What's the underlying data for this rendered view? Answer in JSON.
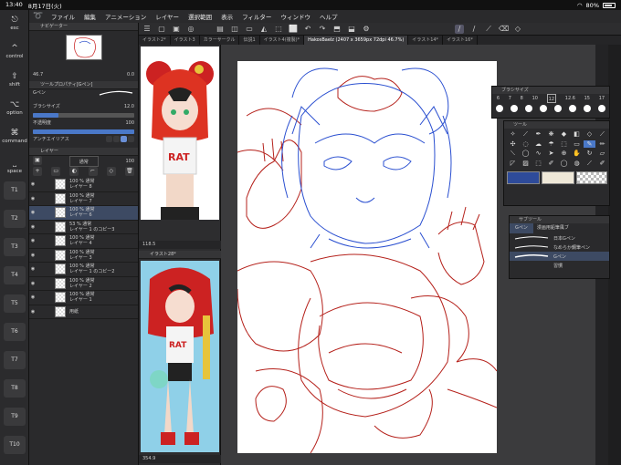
{
  "status": {
    "time": "13:40",
    "date": "8月17日(火)",
    "battery": "80%",
    "battery_level": 0.8
  },
  "menu": [
    "ファイル",
    "編集",
    "アニメーション",
    "レイヤー",
    "選択範囲",
    "表示",
    "フィルター",
    "ウィンドウ",
    "ヘルプ"
  ],
  "modifiers": [
    {
      "glyph": "⎋",
      "label": "esc"
    },
    {
      "glyph": "^",
      "label": "control"
    },
    {
      "glyph": "⇧",
      "label": "shift"
    },
    {
      "glyph": "⌥",
      "label": "option"
    },
    {
      "glyph": "⌘",
      "label": "command"
    },
    {
      "glyph": "⎵",
      "label": "space"
    }
  ],
  "tkeys": [
    "T1",
    "T2",
    "T3",
    "T4",
    "T5",
    "T6",
    "T7",
    "T8",
    "T9",
    "T10"
  ],
  "tabs": [
    "イラスト2*",
    "イラスト3",
    "カラーサークル",
    "伝説1",
    "イラスト4(複製)*",
    "HakosBaelz (2407 x 3659px 72dpi 46.7%)",
    "イラスト14*",
    "イラスト16*"
  ],
  "navigator": {
    "title": "ナビゲーター",
    "zoom": "46.7",
    "angle": "0.0"
  },
  "toolprop": {
    "title": "ツールプロパティ[Gペン]",
    "brush_label": "Gペン",
    "size_label": "ブラシサイズ",
    "size_value": "12.0",
    "size_level": 0.25,
    "opacity_label": "不透明度",
    "opacity_value": "100",
    "opacity_level": 1.0,
    "aa_label": "アンチエイリアス"
  },
  "layers_panel": {
    "title": "レイヤー",
    "blend": "通常",
    "opacity": "100",
    "items": [
      {
        "pct": "100 %",
        "mode": "通常",
        "name": "レイヤー 8",
        "selected": false
      },
      {
        "pct": "100 %",
        "mode": "通常",
        "name": "レイヤー 7",
        "selected": false
      },
      {
        "pct": "100 %",
        "mode": "通常",
        "name": "レイヤー 6",
        "selected": true
      },
      {
        "pct": "53 %",
        "mode": "通常",
        "name": "レイヤー 1 のコピー3",
        "selected": false
      },
      {
        "pct": "100 %",
        "mode": "通常",
        "name": "レイヤー 4",
        "selected": false
      },
      {
        "pct": "100 %",
        "mode": "通常",
        "name": "レイヤー 3",
        "selected": false
      },
      {
        "pct": "100 %",
        "mode": "通常",
        "name": "レイヤー 1 のコピー2",
        "selected": false
      },
      {
        "pct": "100 %",
        "mode": "通常",
        "name": "レイヤー 2",
        "selected": false
      },
      {
        "pct": "100 %",
        "mode": "通常",
        "name": "レイヤー 1",
        "selected": false
      },
      {
        "pct": "",
        "mode": "",
        "name": "用紙",
        "selected": false
      }
    ]
  },
  "ref_top": {
    "zoom": "118.5"
  },
  "ref_bottom": {
    "title": "イラスト28*",
    "zoom": "354.9"
  },
  "brushsize": {
    "title": "ブラシサイズ",
    "sizes": [
      "6",
      "7",
      "8",
      "10",
      "12",
      "12.6",
      "15",
      "17"
    ],
    "selected": "12"
  },
  "tool_panel": {
    "title": "ツール"
  },
  "colors": {
    "main": "#2e4b9a",
    "sub": "#efe8d8",
    "accent": "#4a78c8",
    "sketch_red": "#b5211b",
    "sketch_blue": "#2a4fd0"
  },
  "subtool": {
    "title": "サブツール",
    "pen_tab": "Gペン",
    "other_tab": "漫画用鉛筆風ブ",
    "items": [
      "日本Gペン",
      "なめらか鋼筆ペン",
      "Gペン",
      "習慣"
    ],
    "selected": "Gペン"
  },
  "chart_data": null
}
